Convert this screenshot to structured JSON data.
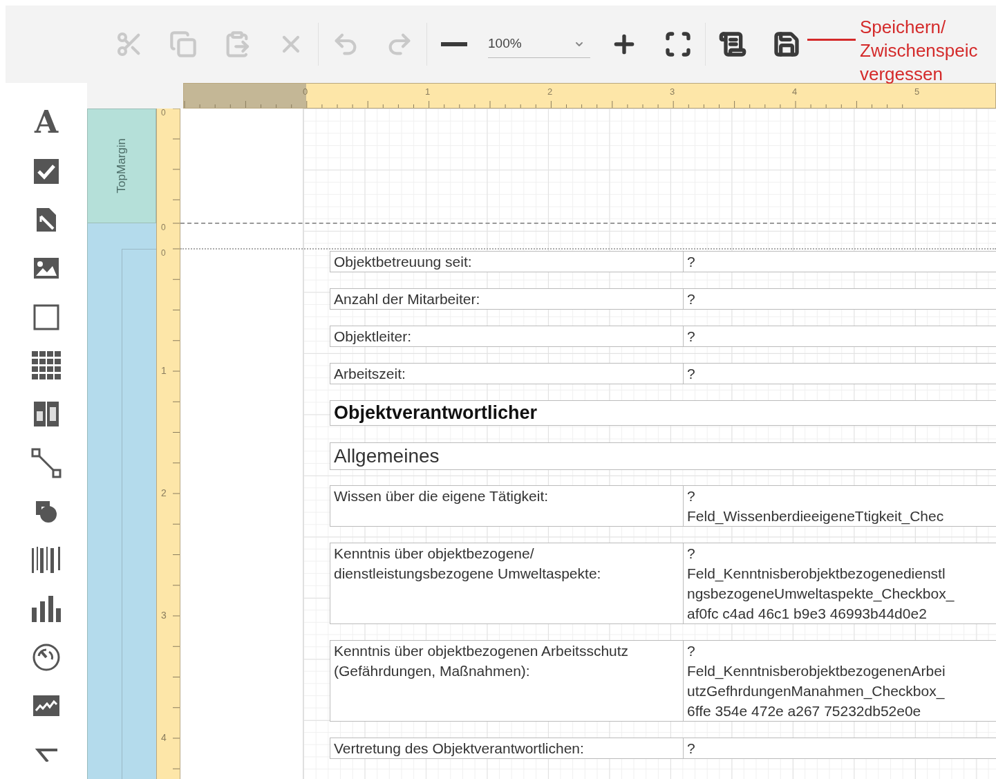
{
  "toolbar": {
    "buttons": [
      {
        "kind": "cut",
        "disabled": true
      },
      {
        "kind": "copy",
        "disabled": true
      },
      {
        "kind": "paste",
        "disabled": true
      },
      {
        "kind": "delete",
        "disabled": true
      },
      {
        "kind": "separator"
      },
      {
        "kind": "undo",
        "disabled": true
      },
      {
        "kind": "redo",
        "disabled": true
      },
      {
        "kind": "separator"
      },
      {
        "kind": "zoom-out",
        "disabled": false
      },
      {
        "kind": "zoom",
        "value": "100%"
      },
      {
        "kind": "zoom-in",
        "disabled": false
      },
      {
        "kind": "fit",
        "disabled": false
      },
      {
        "kind": "separator"
      },
      {
        "kind": "scripts",
        "disabled": false
      },
      {
        "kind": "save",
        "disabled": false
      }
    ]
  },
  "annotation": {
    "lines": [
      "Speichern/",
      "Zwischenspeic",
      "vergessen"
    ]
  },
  "toolbox": {
    "label_glyph": "A"
  },
  "horizontal_ruler": [
    "0",
    "1",
    "2",
    "3",
    "4",
    "5"
  ],
  "band_origins": [
    "0",
    "0",
    "0"
  ],
  "vertical_ruler": [
    "1",
    "2",
    "3",
    "4"
  ],
  "bands": [
    {
      "label": "TopMargin"
    }
  ],
  "controls": [
    {
      "kind": "field",
      "label": [
        "Objektbetreuung seit:"
      ],
      "value": [
        "?"
      ]
    },
    {
      "kind": "field",
      "label": [
        "Anzahl der Mitarbeiter:"
      ],
      "value": [
        "?"
      ]
    },
    {
      "kind": "field",
      "label": [
        "Objektleiter:"
      ],
      "value": [
        "?"
      ]
    },
    {
      "kind": "field",
      "label": [
        "Arbeitszeit:"
      ],
      "value": [
        "?"
      ]
    },
    {
      "kind": "heading",
      "text": "Objektverantwortlicher"
    },
    {
      "kind": "subheading",
      "text": "Allgemeines"
    },
    {
      "kind": "field",
      "label": [
        "Wissen über die eigene Tätigkeit:"
      ],
      "value": [
        "?",
        "Feld_WissenberdieeigeneTtigkeit_Chec"
      ]
    },
    {
      "kind": "field",
      "label": [
        "Kenntnis über objektbezogene/",
        "dienstleistungsbezogene Umweltaspekte:"
      ],
      "value": [
        "?",
        "Feld_Kenntnisberobjektbezogenedienstl",
        "ngsbezogeneUmweltaspekte_Checkbox_",
        "af0fc c4ad 46c1 b9e3 46993b44d0e2"
      ]
    },
    {
      "kind": "field",
      "label": [
        "Kenntnis über objektbezogenen Arbeitsschutz",
        "(Gefährdungen, Maßnahmen):"
      ],
      "value": [
        "?",
        "Feld_KenntnisberobjektbezogenenArbei",
        "utzGefhrdungenManahmen_Checkbox_",
        "6ffe 354e 472e a267 75232db52e0e"
      ]
    },
    {
      "kind": "field",
      "label": [
        "Vertretung des Objektverantwortlichen:"
      ],
      "value": [
        "?"
      ]
    }
  ]
}
